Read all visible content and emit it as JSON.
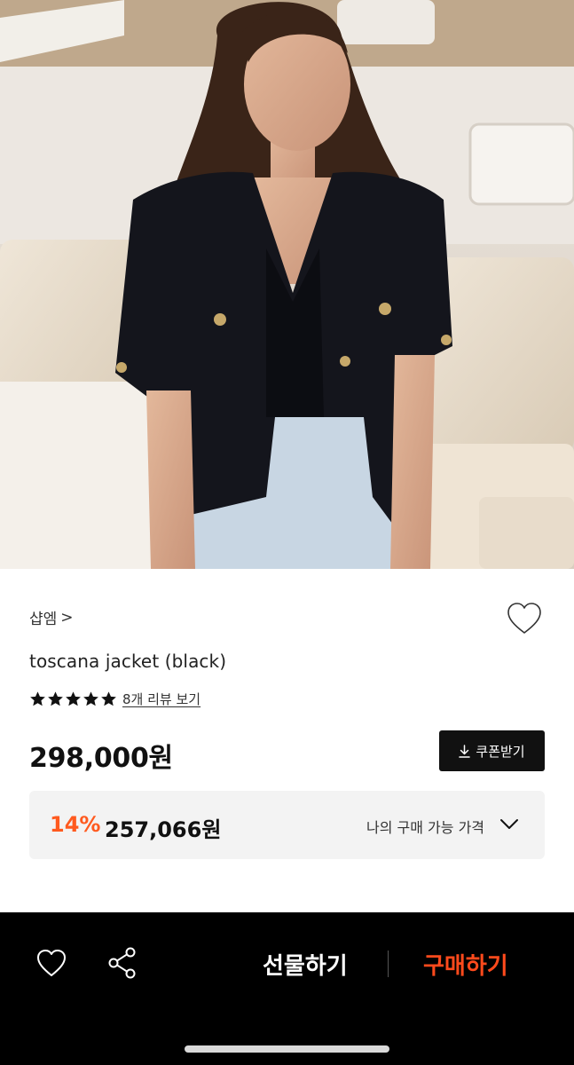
{
  "product": {
    "brand": "샵엠",
    "brand_chevron": ">",
    "title": "toscana jacket (black)",
    "rating_stars": 5,
    "review_link": "8개 리뷰 보기",
    "price": "298,000원",
    "coupon_label": "쿠폰받기",
    "discount_percent": "14%",
    "discount_price": "257,066원",
    "my_price_label": "나의 구매 가능 가격"
  },
  "bottom_bar": {
    "gift_label": "선물하기",
    "buy_label": "구매하기"
  },
  "colors": {
    "accent": "#ff5a1f",
    "buy_accent": "#ff4a1c",
    "bar_background": "#000000"
  },
  "icons": [
    "heart-outline-icon",
    "star-icon",
    "download-icon",
    "chevron-down-icon",
    "share-icon"
  ]
}
